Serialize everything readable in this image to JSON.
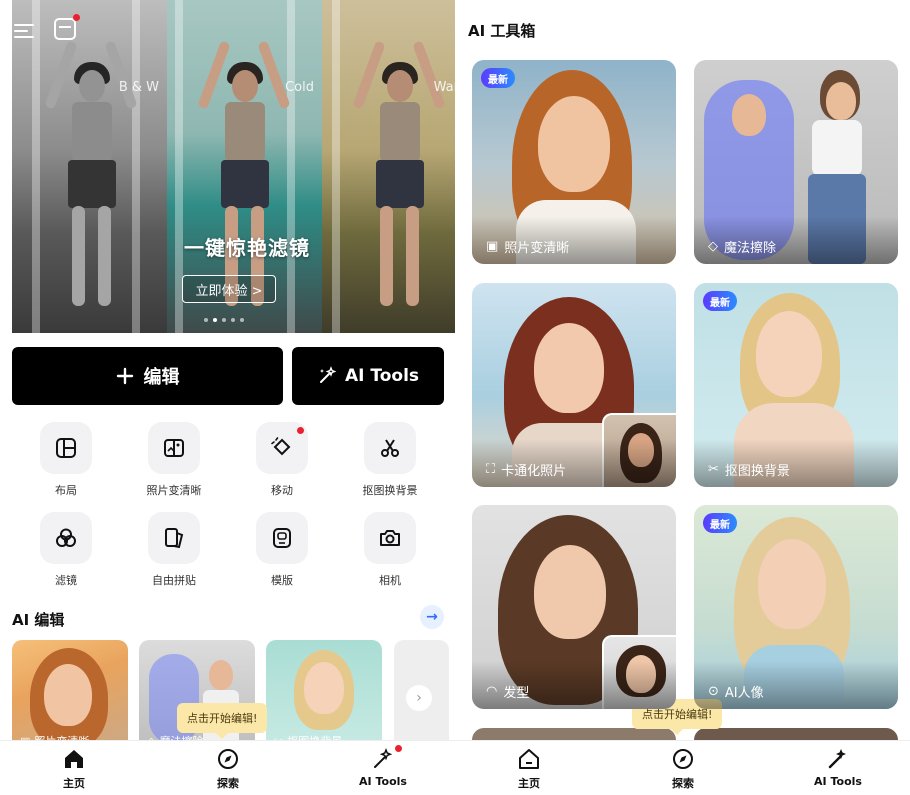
{
  "left": {
    "banner": {
      "filters": [
        "B & W",
        "Cold",
        "War"
      ],
      "title": "一键惊艳滤镜",
      "cta": "立即体验 >"
    },
    "actions": {
      "edit_label": "编辑",
      "ai_tools_label": "AI Tools"
    },
    "tools": [
      {
        "label": "布局",
        "icon": "layout-icon"
      },
      {
        "label": "照片变清晰",
        "icon": "enhance-icon"
      },
      {
        "label": "移动",
        "icon": "move-icon"
      },
      {
        "label": "抠图换背景",
        "icon": "cutout-icon"
      },
      {
        "label": "滤镜",
        "icon": "filter-icon"
      },
      {
        "label": "自由拼贴",
        "icon": "freestyle-icon"
      },
      {
        "label": "模版",
        "icon": "template-icon"
      },
      {
        "label": "相机",
        "icon": "camera-icon"
      }
    ],
    "ai_section_title": "AI 编辑",
    "ai_thumbs": [
      {
        "label": "照片变清晰"
      },
      {
        "label": "魔法擦除"
      },
      {
        "label": "抠图换背景"
      }
    ],
    "tooltip": "点击开始编辑!",
    "nav": [
      {
        "label": "主页",
        "icon": "home-icon"
      },
      {
        "label": "探索",
        "icon": "explore-icon"
      },
      {
        "label": "AI Tools",
        "icon": "ai-tools-icon"
      }
    ]
  },
  "right": {
    "title": "AI 工具箱",
    "badge": "最新",
    "cards": [
      {
        "label": "照片变清晰",
        "badge": true
      },
      {
        "label": "魔法擦除",
        "badge": false
      },
      {
        "label": "卡通化照片",
        "badge": false
      },
      {
        "label": "抠图换背景",
        "badge": true
      },
      {
        "label": "发型",
        "badge": false
      },
      {
        "label": "AI人像",
        "badge": true
      }
    ],
    "tooltip": "点击开始编辑!",
    "nav": [
      {
        "label": "主页",
        "icon": "home-icon"
      },
      {
        "label": "探索",
        "icon": "explore-icon"
      },
      {
        "label": "AI Tools",
        "icon": "ai-tools-icon"
      }
    ]
  },
  "colors": {
    "accent_blue": "#2f6bff",
    "notification_red": "#e8232f",
    "badge_gradient": [
      "#5b3bff",
      "#2b8cff"
    ],
    "tooltip_bg": "#fbe8a8"
  }
}
